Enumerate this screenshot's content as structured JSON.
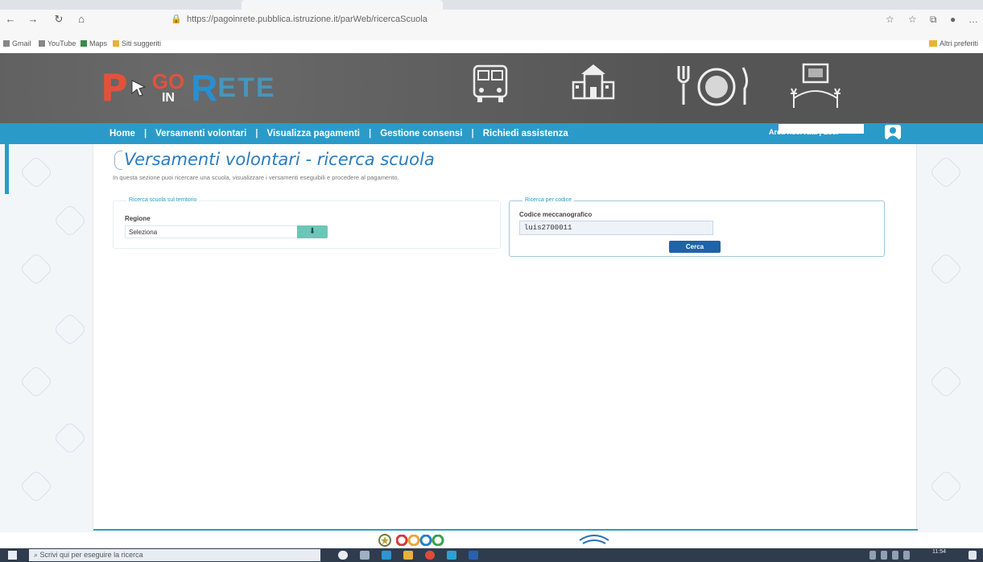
{
  "browser": {
    "url": "https://pagoinrete.pubblica.istruzione.it/parWeb/ricercaScuola",
    "bookmarks": [
      "Gmail",
      "YouTube",
      "Maps",
      "Siti suggeriti"
    ],
    "other_bookmarks": "Altri preferiti"
  },
  "header": {
    "logo": {
      "p": "P",
      "go": "GO",
      "in": "IN",
      "r": "R",
      "ete": "ETE"
    }
  },
  "menu": {
    "items": [
      "Home",
      "Versamenti volontari",
      "Visualizza pagamenti",
      "Gestione consensi",
      "Richiedi assistenza"
    ],
    "area_riservata": "Area riservata | Esci"
  },
  "page": {
    "title": "Versamenti volontari - ricerca scuola",
    "intro": "In questa sezione puoi ricercare una scuola, visualizzare i versamenti eseguibili e procedere al pagamento."
  },
  "search_territorio": {
    "legend": "Ricerca scuola sul territorio",
    "label": "Regione",
    "selected": "Seleziona"
  },
  "search_codice": {
    "legend": "Ricerca per codice",
    "label": "Codice meccanografico",
    "value": "luis2700011",
    "button": "Cerca"
  },
  "taskbar": {
    "search_placeholder": "Scrivi qui per eseguire la ricerca",
    "time": "11:54"
  },
  "colors": {
    "brand_blue": "#2a9bc9",
    "button_blue": "#1f63a8",
    "logo_red": "#e2523b",
    "select_green": "#6cc6b7"
  }
}
